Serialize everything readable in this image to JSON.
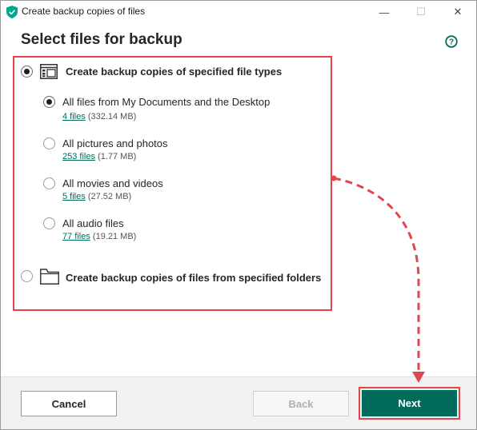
{
  "window": {
    "title": "Create backup copies of files",
    "minimize_glyph": "—",
    "maximize_glyph": "☐",
    "close_glyph": "✕"
  },
  "header": {
    "title": "Select files for backup",
    "help_icon": "help-circle-icon"
  },
  "options": {
    "file_types": {
      "label": "Create backup copies of specified file types",
      "selected": true,
      "icon": "file-types-icon"
    },
    "sub_options": [
      {
        "label": "All files from My Documents and the Desktop",
        "link": "4 files",
        "size": "(332.14 MB)",
        "selected": true
      },
      {
        "label": "All pictures and photos",
        "link": "253 files",
        "size": "(1.77 MB)",
        "selected": false
      },
      {
        "label": "All movies and videos",
        "link": "5 files",
        "size": "(27.52 MB)",
        "selected": false
      },
      {
        "label": "All audio files",
        "link": "77 files",
        "size": "(19.21 MB)",
        "selected": false
      }
    ],
    "folders": {
      "label": "Create backup copies of files from specified folders",
      "selected": false,
      "icon": "folder-icon"
    }
  },
  "footer": {
    "cancel_label": "Cancel",
    "back_label": "Back",
    "next_label": "Next"
  },
  "colors": {
    "accent": "#006d5b",
    "highlight": "#e0474c"
  }
}
